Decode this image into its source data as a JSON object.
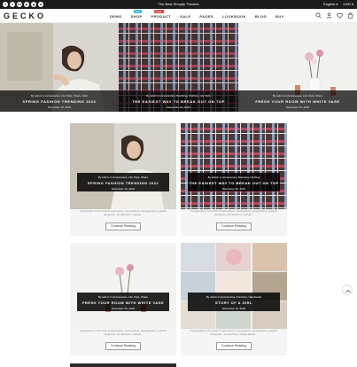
{
  "topbar": {
    "socials": [
      "f",
      "t",
      "in",
      "p",
      "g",
      "o"
    ],
    "promo": "The Best Shopify Themes",
    "language": "English",
    "currency": "USD"
  },
  "header": {
    "logo": "GECKO",
    "nav": [
      {
        "label": "DEMO",
        "badge": ""
      },
      {
        "label": "SHOP",
        "badge": "hot"
      },
      {
        "label": "PRODUCT",
        "badge": "new"
      },
      {
        "label": "SALE",
        "badge": ""
      },
      {
        "label": "PAGES",
        "badge": ""
      },
      {
        "label": "LOOKBOOK",
        "badge": ""
      },
      {
        "label": "BLOG",
        "badge": ""
      },
      {
        "label": "BUY",
        "badge": ""
      }
    ],
    "cart_count": "0"
  },
  "slider": [
    {
      "cats": "By admin in Accessories, Life Style, Share, Shirt",
      "title": "SPRING FASHION TRENDING 2022",
      "date": "December 16, 2022"
    },
    {
      "cats": "By admin in Accessories, Branding, Clothing, Life Style",
      "title": "THE EASIEST WAY TO BREAK OUT ON TOP",
      "date": "December 16, 2022"
    },
    {
      "cats": "By admin in Accessories, Life Style, Share",
      "title": "FRESH YOUR ROOM WITH WHITE VASE",
      "date": "December 16, 2022"
    }
  ],
  "posts": [
    {
      "cats": "By admin in Accessories, Life Style, Share",
      "title": "SPRING FASHION TRENDING 2022",
      "date": "December 16, 2022",
      "excerpt": "Typography is the work of typesetters, compositors, typographers, graphic designers, art directors, manga...",
      "button": "Continue Reading"
    },
    {
      "cats": "By admin in Accessories, Branding, Clothing",
      "title": "THE EASIEST WAY TO BREAK OUT ON TOP",
      "date": "December 16, 2022",
      "excerpt": "Typography is the work of typesetters, compositors, typographers, graphic designers, art directors, manga...",
      "button": "Continue Reading"
    },
    {
      "cats": "By admin in Accessories, Life Style, Share",
      "title": "FRESH YOUR ROOM WITH WHITE VASE",
      "date": "December 16, 2022",
      "excerpt": "Typography is the work of typesetters, compositors, typographers, graphic designers, art directors, manga...",
      "button": "Continue Reading"
    },
    {
      "cats": "By admin in Accessories, Furniture, Handmade",
      "title": "STORY OF A GIRL",
      "date": "December 16, 2022",
      "excerpt": "Typography is the work of typesetters, compositors, typographers, graphic designers, art directors, manga artists...",
      "button": "Continue Reading"
    }
  ],
  "colors": {
    "hot_badge": "#2db3d6",
    "new_badge": "#e2453c",
    "topbar": "#1b1b1b"
  }
}
